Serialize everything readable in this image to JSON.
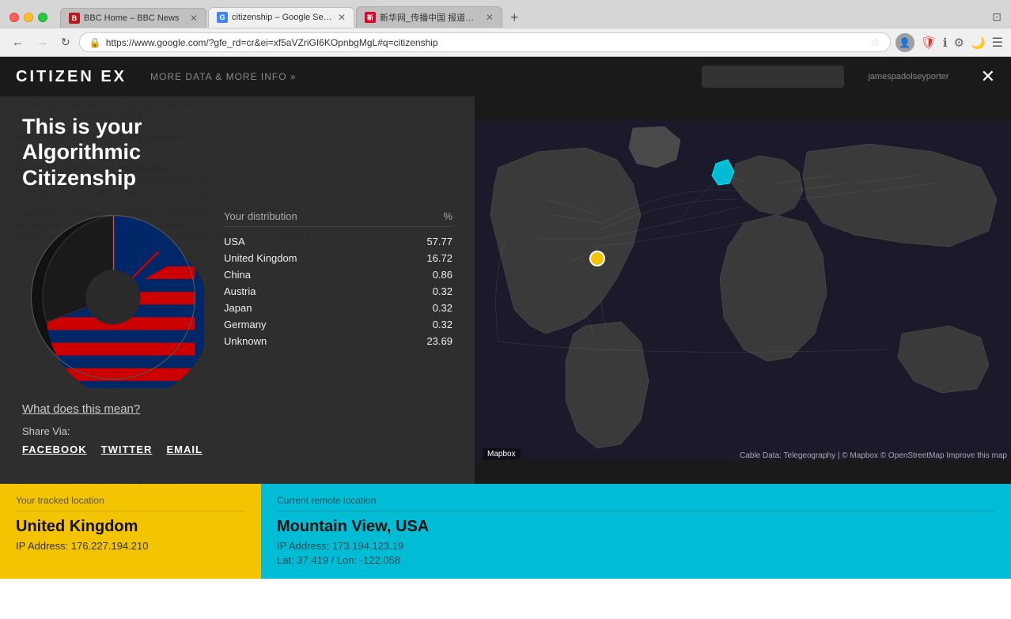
{
  "browser": {
    "tabs": [
      {
        "id": 1,
        "label": "BBC Home – BBC News",
        "favicon_color": "#bb1919",
        "active": false
      },
      {
        "id": 2,
        "label": "citizenship – Google Searc…",
        "favicon_color": "#4285f4",
        "active": true
      },
      {
        "id": 3,
        "label": "新华网_传播中国 报道世界",
        "favicon_color": "#e60026",
        "active": false
      }
    ],
    "url": "https://www.google.com/?gfe_rd=cr&ei=xf5aVZriGI6KOpnbgMgL#q=citizenship",
    "back_disabled": false,
    "forward_disabled": true
  },
  "citizen_ex": {
    "logo": "CITIZEN EX",
    "more_info": "MORE DATA & MORE INFO »",
    "username": "jamespadolseyporter",
    "close_label": "✕",
    "title": "This is your Algorithmic Citizenship",
    "distribution_header": "Your distribution",
    "percent_header": "%",
    "distribution": [
      {
        "country": "USA",
        "percent": "57.77"
      },
      {
        "country": "United Kingdom",
        "percent": "16.72"
      },
      {
        "country": "China",
        "percent": "0.86"
      },
      {
        "country": "Austria",
        "percent": "0.32"
      },
      {
        "country": "Japan",
        "percent": "0.32"
      },
      {
        "country": "Germany",
        "percent": "0.32"
      },
      {
        "country": "Unknown",
        "percent": "23.69"
      }
    ],
    "what_does_label": "What does this mean?",
    "share_label": "Share Via:",
    "share_links": [
      {
        "label": "FACEBOOK",
        "key": "facebook"
      },
      {
        "label": "TWITTER",
        "key": "twitter"
      },
      {
        "label": "EMAIL",
        "key": "email"
      }
    ],
    "mapbox_label": "Mapbox",
    "map_credit": "Cable Data: Telegeography | © Mapbox  © OpenStreetMap  Improve this map",
    "tracked_location_label": "Your tracked location",
    "tracked_country": "United Kingdom",
    "tracked_ip": "IP Address: 176.227.194.210",
    "remote_location_label": "Current remote location",
    "remote_city": "Mountain View, USA",
    "remote_ip": "IP Address: 173.194.123.19",
    "remote_latlon": "Lat: 37.419 / Lon: -122.058"
  },
  "google_results": [
    {
      "title": "British citizenship - GOV.UK",
      "url": "https://www.gov.uk/browse/citizenship/citizenship",
      "url_display": "https://www.gov.uk/browse/citizenship/citizenship ▾  United Kingdom ▾",
      "snippet": "British citizenship. A to Z. Become a British … Citizenship and living in the UK.\nBritish citizenship. Becoming a citizen, Life in the UK test and getting a passport …",
      "has_check": true
    },
    {
      "title": "Citizenship and living in the UK - GOV.UK",
      "url": "https://www.gov.uk/browse/citizenship",
      "url_display": "",
      "snippet": "",
      "has_check": true
    }
  ]
}
